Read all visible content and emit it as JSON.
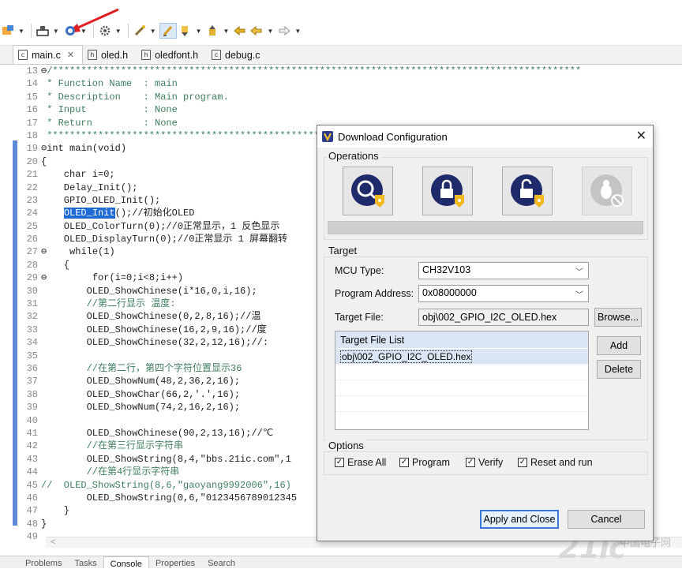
{
  "toolbar": {
    "icons": [
      "build-icon",
      "download-icon",
      "debug-icon",
      "gear-icon",
      "brush-icon",
      "highlight-icon",
      "sort-icon",
      "next-annotation-icon",
      "prev-annotation-icon",
      "back-icon",
      "forward-icon"
    ]
  },
  "tabs": [
    {
      "label": "main.c",
      "icon": "c",
      "active": true
    },
    {
      "label": "oled.h",
      "icon": "h",
      "active": false
    },
    {
      "label": "oledfont.h",
      "icon": "h",
      "active": false
    },
    {
      "label": "debug.c",
      "icon": "c",
      "active": false
    }
  ],
  "code_lines": [
    {
      "n": "13",
      "fold": "⊖",
      "text": "/*********************************************************************************************"
    },
    {
      "n": "14",
      "text": " * Function Name  : main"
    },
    {
      "n": "15",
      "text": " * Description    : Main program."
    },
    {
      "n": "16",
      "text": " * Input          : None"
    },
    {
      "n": "17",
      "text": " * Return         : None"
    },
    {
      "n": "18",
      "text": " *********************************************************************************************"
    },
    {
      "n": "19",
      "fold": "⊖",
      "text": "int main(void)"
    },
    {
      "n": "20",
      "text": "{"
    },
    {
      "n": "21",
      "text": "    char i=0;"
    },
    {
      "n": "22",
      "text": "    Delay_Init();"
    },
    {
      "n": "23",
      "text": "    GPIO_OLED_Init();"
    },
    {
      "n": "24",
      "text": "    OLED_Init();//初始化OLED"
    },
    {
      "n": "25",
      "text": "    OLED_ColorTurn(0);//0正常显示，1 反色显示"
    },
    {
      "n": "26",
      "text": "    OLED_DisplayTurn(0);//0正常显示 1 屏幕翻转"
    },
    {
      "n": "27",
      "fold": "⊖",
      "text": "    while(1)"
    },
    {
      "n": "28",
      "text": "    {"
    },
    {
      "n": "29",
      "fold": "⊖",
      "text": "        for(i=0;i<8;i++)"
    },
    {
      "n": "30",
      "text": "        OLED_ShowChinese(i*16,0,i,16);"
    },
    {
      "n": "31",
      "text": "        //第二行显示 温度:"
    },
    {
      "n": "32",
      "text": "        OLED_ShowChinese(0,2,8,16);//温"
    },
    {
      "n": "33",
      "text": "        OLED_ShowChinese(16,2,9,16);//度"
    },
    {
      "n": "34",
      "text": "        OLED_ShowChinese(32,2,12,16);//:"
    },
    {
      "n": "35",
      "text": ""
    },
    {
      "n": "36",
      "text": "        //在第二行，第四个字符位置显示36"
    },
    {
      "n": "37",
      "text": "        OLED_ShowNum(48,2,36,2,16);"
    },
    {
      "n": "38",
      "text": "        OLED_ShowChar(66,2,'.',16);"
    },
    {
      "n": "39",
      "text": "        OLED_ShowNum(74,2,16,2,16);"
    },
    {
      "n": "40",
      "text": ""
    },
    {
      "n": "41",
      "text": "        OLED_ShowChinese(90,2,13,16);//℃"
    },
    {
      "n": "42",
      "text": "        //在第三行显示字符串"
    },
    {
      "n": "43",
      "text": "        OLED_ShowString(8,4,\"bbs.21ic.com\",1"
    },
    {
      "n": "44",
      "text": "        //在第4行显示字符串"
    },
    {
      "n": "45",
      "text": "//  OLED_ShowString(8,6,\"gaoyang9992006\",16)"
    },
    {
      "n": "46",
      "text": "        OLED_ShowString(0,6,\"0123456789012345"
    },
    {
      "n": "47",
      "text": "    }"
    },
    {
      "n": "48",
      "fold": "",
      "text": "}"
    },
    {
      "n": "49",
      "text": ""
    }
  ],
  "bottom_tabs": [
    "Problems",
    "Tasks",
    "Console",
    "Properties",
    "Search"
  ],
  "dialog": {
    "title": "Download Configuration",
    "operations_label": "Operations",
    "operation_buttons": [
      {
        "name": "query-icon",
        "enabled": true
      },
      {
        "name": "lock-icon",
        "enabled": true
      },
      {
        "name": "unlock-icon",
        "enabled": true
      },
      {
        "name": "bug-icon",
        "enabled": false
      }
    ],
    "target_label": "Target",
    "mcu_type_label": "MCU Type:",
    "mcu_type_value": "CH32V103",
    "program_address_label": "Program Address:",
    "program_address_value": "0x08000000",
    "target_file_label": "Target File:",
    "target_file_value": "obj\\002_GPIO_I2C_OLED.hex",
    "browse_label": "Browse...",
    "target_file_list_header": "Target File List",
    "target_file_list": [
      "obj\\002_GPIO_I2C_OLED.hex"
    ],
    "add_label": "Add",
    "delete_label": "Delete",
    "options_label": "Options",
    "options": [
      {
        "label": "Erase All",
        "checked": true
      },
      {
        "label": "Program",
        "checked": true
      },
      {
        "label": "Verify",
        "checked": true
      },
      {
        "label": "Reset and run",
        "checked": true
      }
    ],
    "apply_close_label": "Apply and Close",
    "cancel_label": "Cancel"
  },
  "watermark": {
    "main": "21ic",
    "sub": "中国电子网"
  }
}
